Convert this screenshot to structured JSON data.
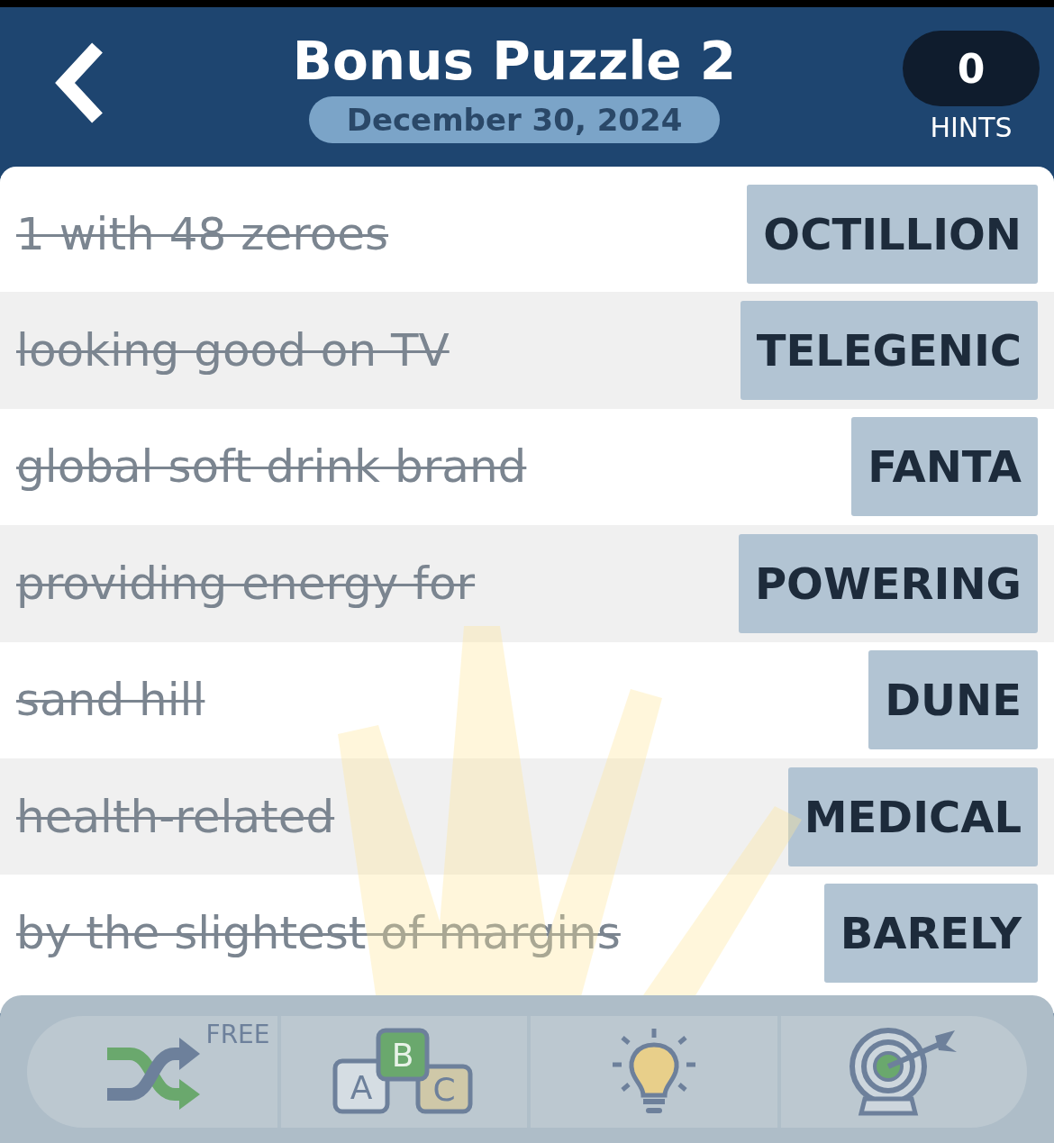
{
  "header": {
    "title": "Bonus Puzzle 2",
    "date": "December 30, 2024",
    "hints": {
      "count": "0",
      "label": "HINTS"
    }
  },
  "clues": [
    {
      "clue": "1 with 48 zeroes",
      "answer": "OCTILLION",
      "solved": true
    },
    {
      "clue": "looking good on TV",
      "answer": "TELEGENIC",
      "solved": true
    },
    {
      "clue": "global soft drink brand",
      "answer": "FANTA",
      "solved": true
    },
    {
      "clue": "providing energy for",
      "answer": "POWERING",
      "solved": true
    },
    {
      "clue": "sand hill",
      "answer": "DUNE",
      "solved": true
    },
    {
      "clue": "health-related",
      "answer": "MEDICAL",
      "solved": true
    },
    {
      "clue": "by the slightest of margins",
      "answer": "BARELY",
      "solved": true
    }
  ],
  "toolbar": [
    {
      "kind": "shuffle",
      "badge": "FREE"
    },
    {
      "kind": "letters",
      "letters": [
        "A",
        "B",
        "C"
      ]
    },
    {
      "kind": "hint"
    },
    {
      "kind": "target"
    }
  ]
}
